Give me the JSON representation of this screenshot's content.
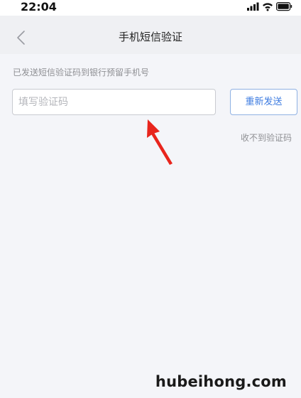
{
  "status_bar": {
    "time": "22:04",
    "icons": [
      "cellular-signal-icon",
      "wifi-icon",
      "battery-icon"
    ]
  },
  "nav": {
    "back_icon": "chevron-left-icon",
    "title": "手机短信验证"
  },
  "main": {
    "hint": "已发送短信验证码到银行预留手机号",
    "code_input": {
      "value": "",
      "placeholder": "填写验证码"
    },
    "resend_label": "重新发送",
    "no_code_label": "收不到验证码"
  },
  "annotation": {
    "arrow_icon": "red-arrow-icon",
    "arrow_color": "#e8251d"
  },
  "watermark": "hubeihong.com",
  "colors": {
    "accent": "#3b7ae0",
    "background": "#f4f5f9",
    "nav_background": "#eff0f3",
    "muted_text": "#8f9094"
  }
}
